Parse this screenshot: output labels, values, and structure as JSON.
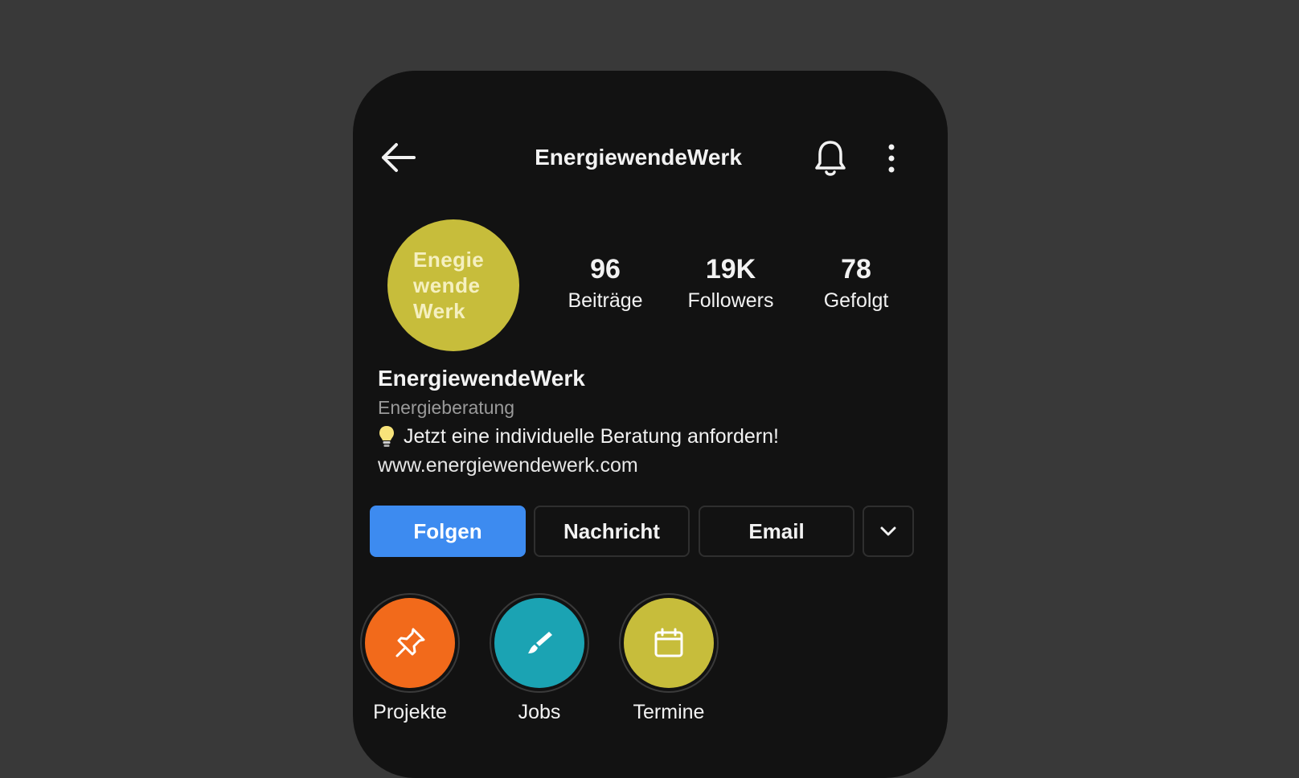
{
  "header": {
    "title": "EnergiewendeWerk"
  },
  "avatar": {
    "lines": [
      "Enegie",
      "wende",
      "Werk"
    ],
    "color": "#c7bd3b"
  },
  "stats": [
    {
      "value": "96",
      "label": "Beiträge"
    },
    {
      "value": "19K",
      "label": "Followers"
    },
    {
      "value": "78",
      "label": "Gefolgt"
    }
  ],
  "bio": {
    "name": "EnergiewendeWerk",
    "category": "Energieberatung",
    "text": "Jetzt eine individuelle Beratung anfordern!",
    "link": "www.energiewendewerk.com"
  },
  "actions": {
    "follow": "Folgen",
    "message": "Nachricht",
    "email": "Email"
  },
  "highlights": [
    {
      "label": "Projekte",
      "icon": "pin-icon",
      "color": "#f26a1b"
    },
    {
      "label": "Jobs",
      "icon": "brush-icon",
      "color": "#1ba3b3"
    },
    {
      "label": "Termine",
      "icon": "calendar-icon",
      "color": "#c7bd3b"
    }
  ],
  "colors": {
    "background": "#393939",
    "phone": "#121212",
    "accent": "#3d8bf0"
  }
}
